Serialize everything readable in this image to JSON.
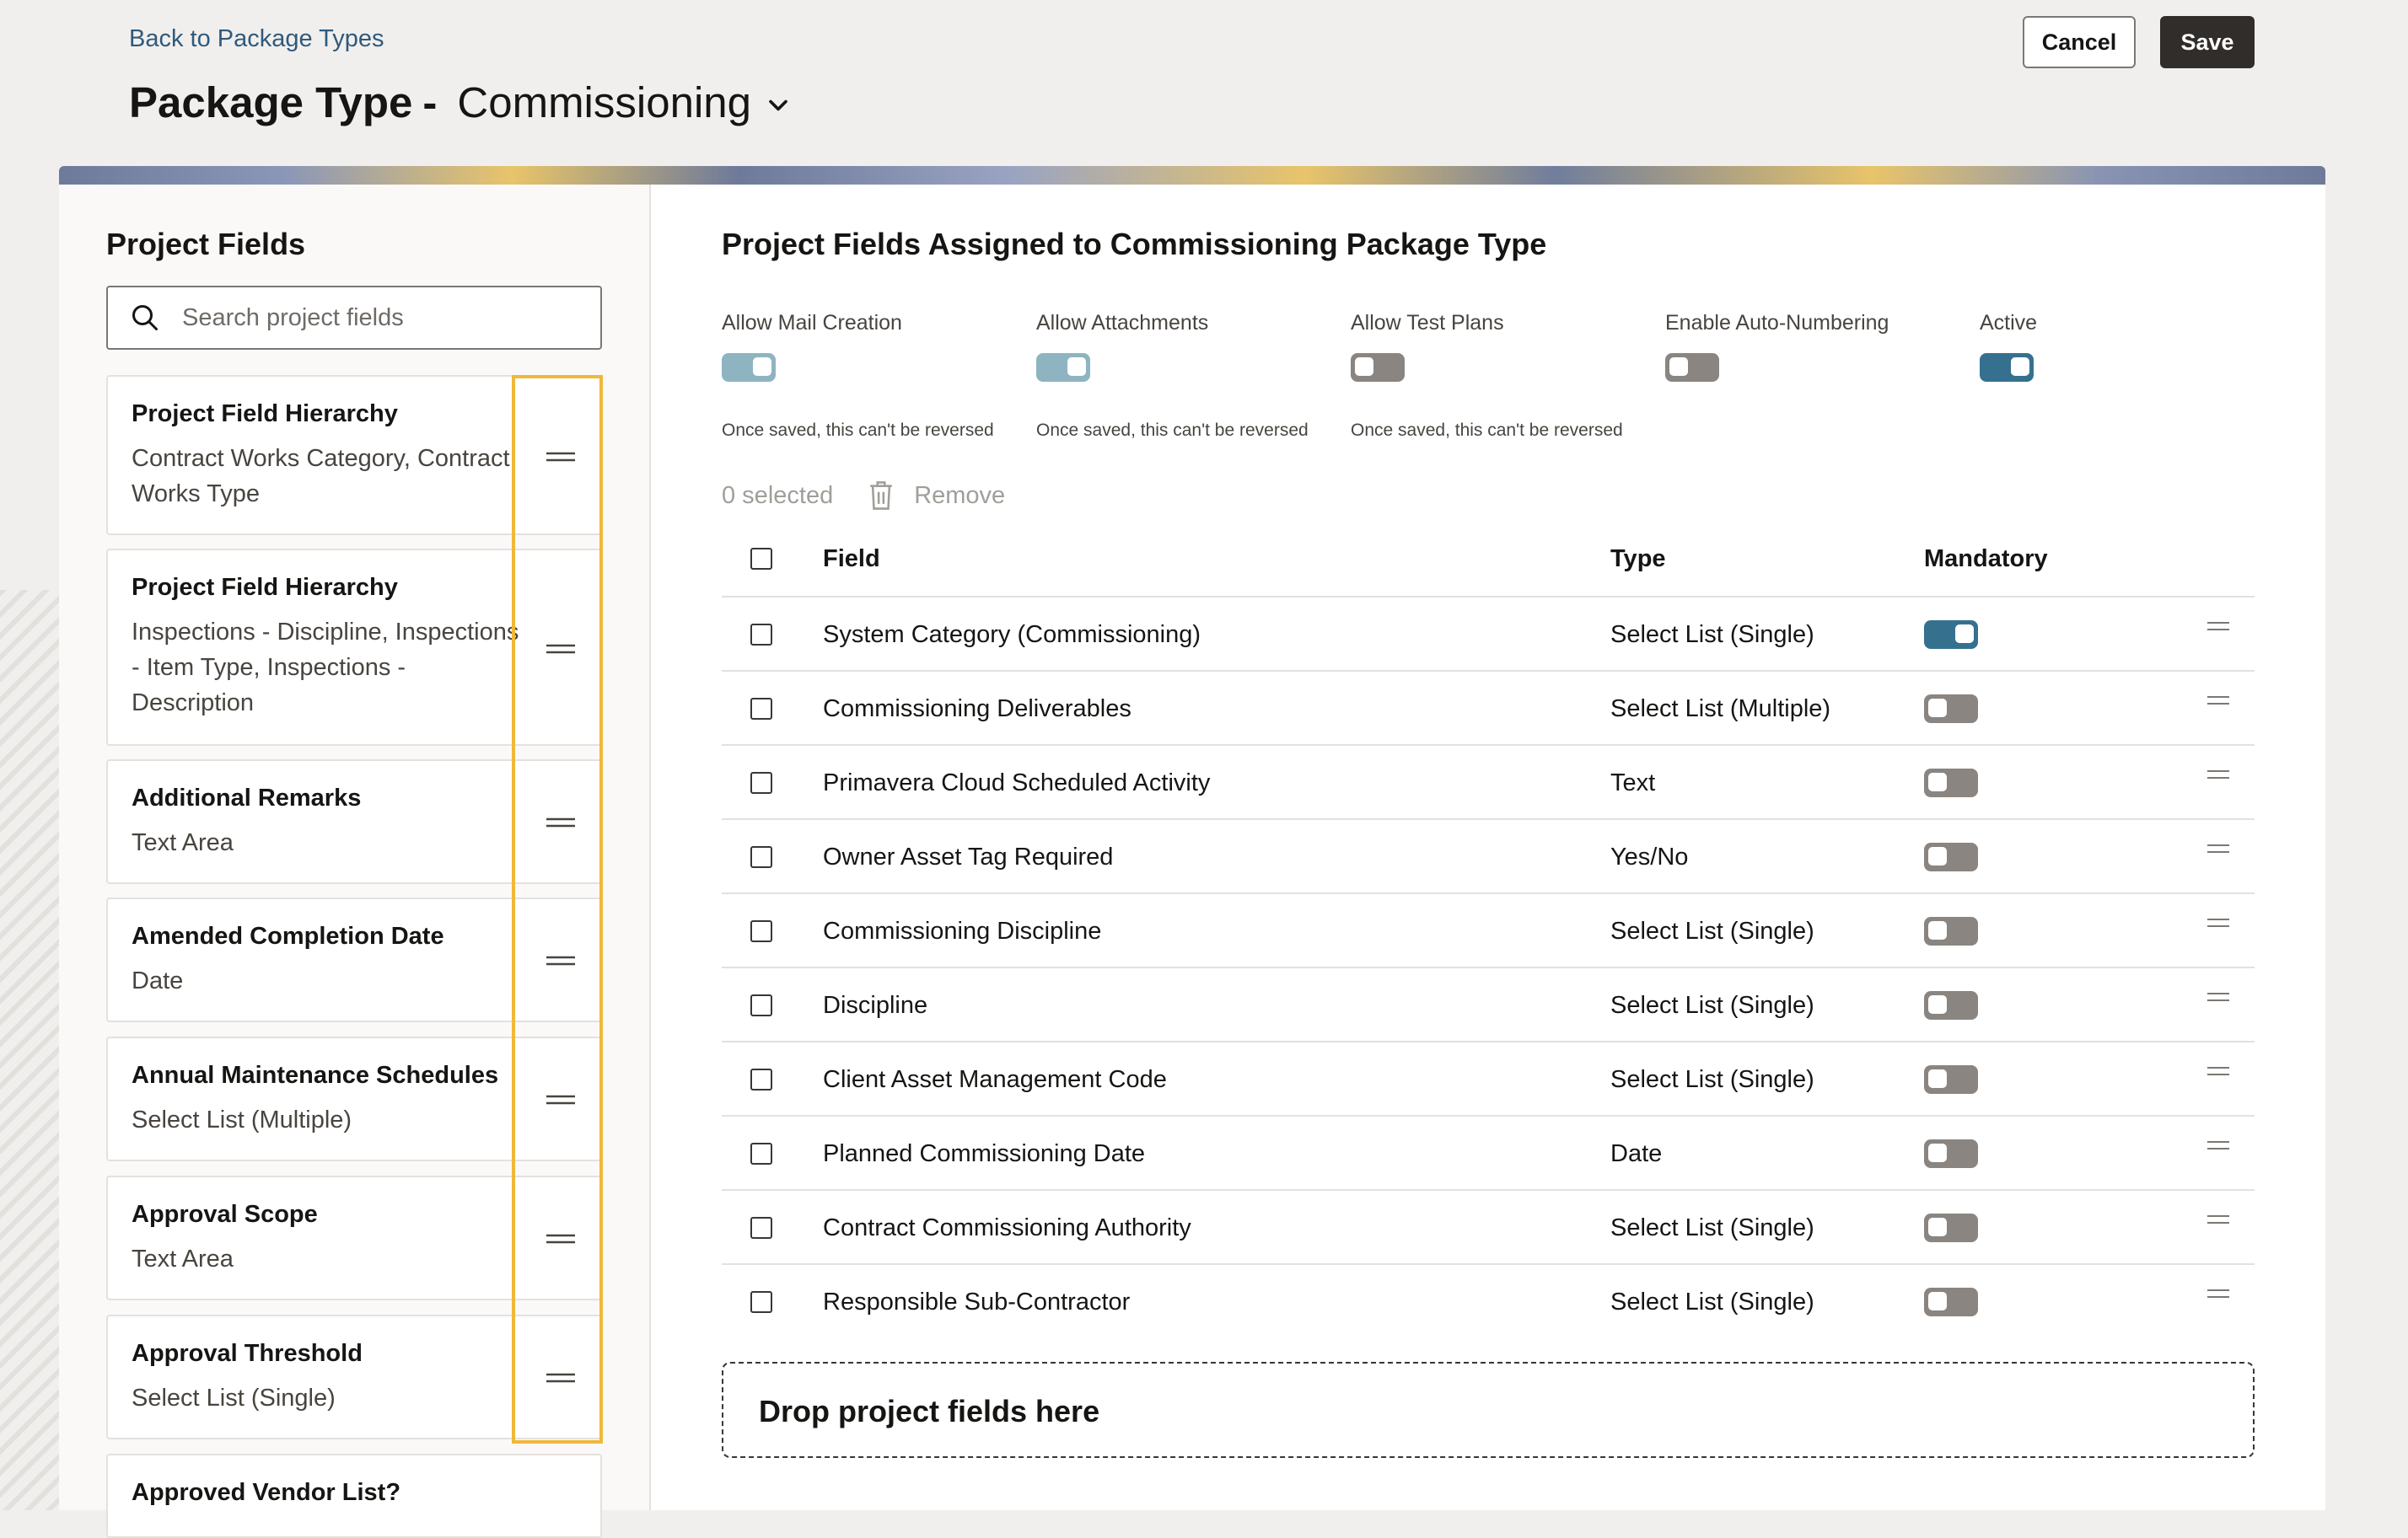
{
  "header": {
    "back_link": "Back to Package Types",
    "title_prefix": "Package Type",
    "title_separator": "-",
    "title_value": "Commissioning",
    "cancel_label": "Cancel",
    "save_label": "Save"
  },
  "left_panel": {
    "title": "Project Fields",
    "search_placeholder": "Search project fields",
    "items": [
      {
        "title": "Project Field Hierarchy",
        "subtitle": "Contract Works Category, Contract Works Type"
      },
      {
        "title": "Project Field Hierarchy",
        "subtitle": "Inspections - Discipline, Inspections - Item Type, Inspections - Description"
      },
      {
        "title": "Additional Remarks",
        "subtitle": "Text Area"
      },
      {
        "title": "Amended Completion Date",
        "subtitle": "Date"
      },
      {
        "title": "Annual Maintenance Schedules",
        "subtitle": "Select List (Multiple)"
      },
      {
        "title": "Approval Scope",
        "subtitle": "Text Area"
      },
      {
        "title": "Approval Threshold",
        "subtitle": "Select List (Single)"
      },
      {
        "title": "Approved Vendor List?",
        "subtitle": ""
      }
    ]
  },
  "right_panel": {
    "title": "Project Fields Assigned to Commissioning Package Type",
    "options": [
      {
        "label": "Allow Mail Creation",
        "state": "on-light",
        "note": "Once saved, this can't be reversed"
      },
      {
        "label": "Allow Attachments",
        "state": "on-light",
        "note": "Once saved, this can't be reversed"
      },
      {
        "label": "Allow Test Plans",
        "state": "off",
        "note": "Once saved, this can't be reversed"
      },
      {
        "label": "Enable Auto-Numbering",
        "state": "off",
        "note": ""
      },
      {
        "label": "Active",
        "state": "on",
        "note": ""
      }
    ],
    "selected_count": "0 selected",
    "remove_label": "Remove",
    "table": {
      "headers": {
        "field": "Field",
        "type": "Type",
        "mandatory": "Mandatory"
      },
      "rows": [
        {
          "field": "System Category (Commissioning)",
          "type": "Select List (Single)",
          "mandatory": true
        },
        {
          "field": "Commissioning Deliverables",
          "type": "Select List (Multiple)",
          "mandatory": false
        },
        {
          "field": "Primavera Cloud Scheduled Activity",
          "type": "Text",
          "mandatory": false
        },
        {
          "field": "Owner Asset Tag Required",
          "type": "Yes/No",
          "mandatory": false
        },
        {
          "field": "Commissioning Discipline",
          "type": "Select List (Single)",
          "mandatory": false
        },
        {
          "field": "Discipline",
          "type": "Select List (Single)",
          "mandatory": false
        },
        {
          "field": "Client Asset Management Code",
          "type": "Select List (Single)",
          "mandatory": false
        },
        {
          "field": "Planned Commissioning Date",
          "type": "Date",
          "mandatory": false
        },
        {
          "field": "Contract Commissioning Authority",
          "type": "Select List (Single)",
          "mandatory": false
        },
        {
          "field": "Responsible Sub-Contractor",
          "type": "Select List (Single)",
          "mandatory": false
        }
      ]
    },
    "dropzone_label": "Drop project fields here"
  },
  "colors": {
    "accent": "#35718f",
    "accent_light": "#8fb4c1",
    "toggle_off": "#8a8580",
    "highlight": "#f0b839",
    "save_bg": "#312d2a"
  }
}
